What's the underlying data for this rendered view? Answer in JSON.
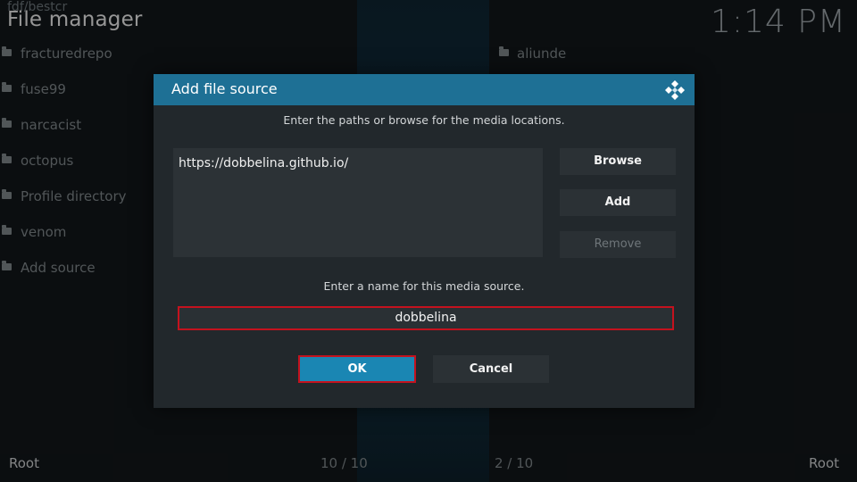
{
  "header": {
    "ghost_title": "fdf/bestcr",
    "title": "File manager",
    "clock": "1:14 PM"
  },
  "left_list": {
    "items": [
      {
        "label": "fracturedrepo",
        "icon": "folder-icon"
      },
      {
        "label": "fuse99",
        "icon": "folder-icon"
      },
      {
        "label": "narcacist",
        "icon": "folder-icon"
      },
      {
        "label": "octopus",
        "icon": "folder-icon"
      },
      {
        "label": "Profile directory",
        "icon": "folder-icon"
      },
      {
        "label": "venom",
        "icon": "folder-icon"
      },
      {
        "label": "Add source",
        "icon": "folder-icon"
      }
    ]
  },
  "right_list": {
    "items": [
      {
        "label": "aliunde",
        "icon": "folder-icon"
      }
    ]
  },
  "footer": {
    "left_root": "Root",
    "left_count": "10 / 10",
    "right_count": "2 / 10",
    "right_root": "Root"
  },
  "dialog": {
    "title": "Add file source",
    "paths_instruction": "Enter the paths or browse for the media locations.",
    "path_value": "https://dobbelina.github.io/",
    "browse_label": "Browse",
    "add_label": "Add",
    "remove_label": "Remove",
    "name_instruction": "Enter a name for this media source.",
    "name_value": "dobbelina",
    "ok_label": "OK",
    "cancel_label": "Cancel"
  },
  "colors": {
    "header_bar": "#1e7095",
    "focus_border": "#c4121e",
    "ok_fill": "#1a86b3"
  }
}
